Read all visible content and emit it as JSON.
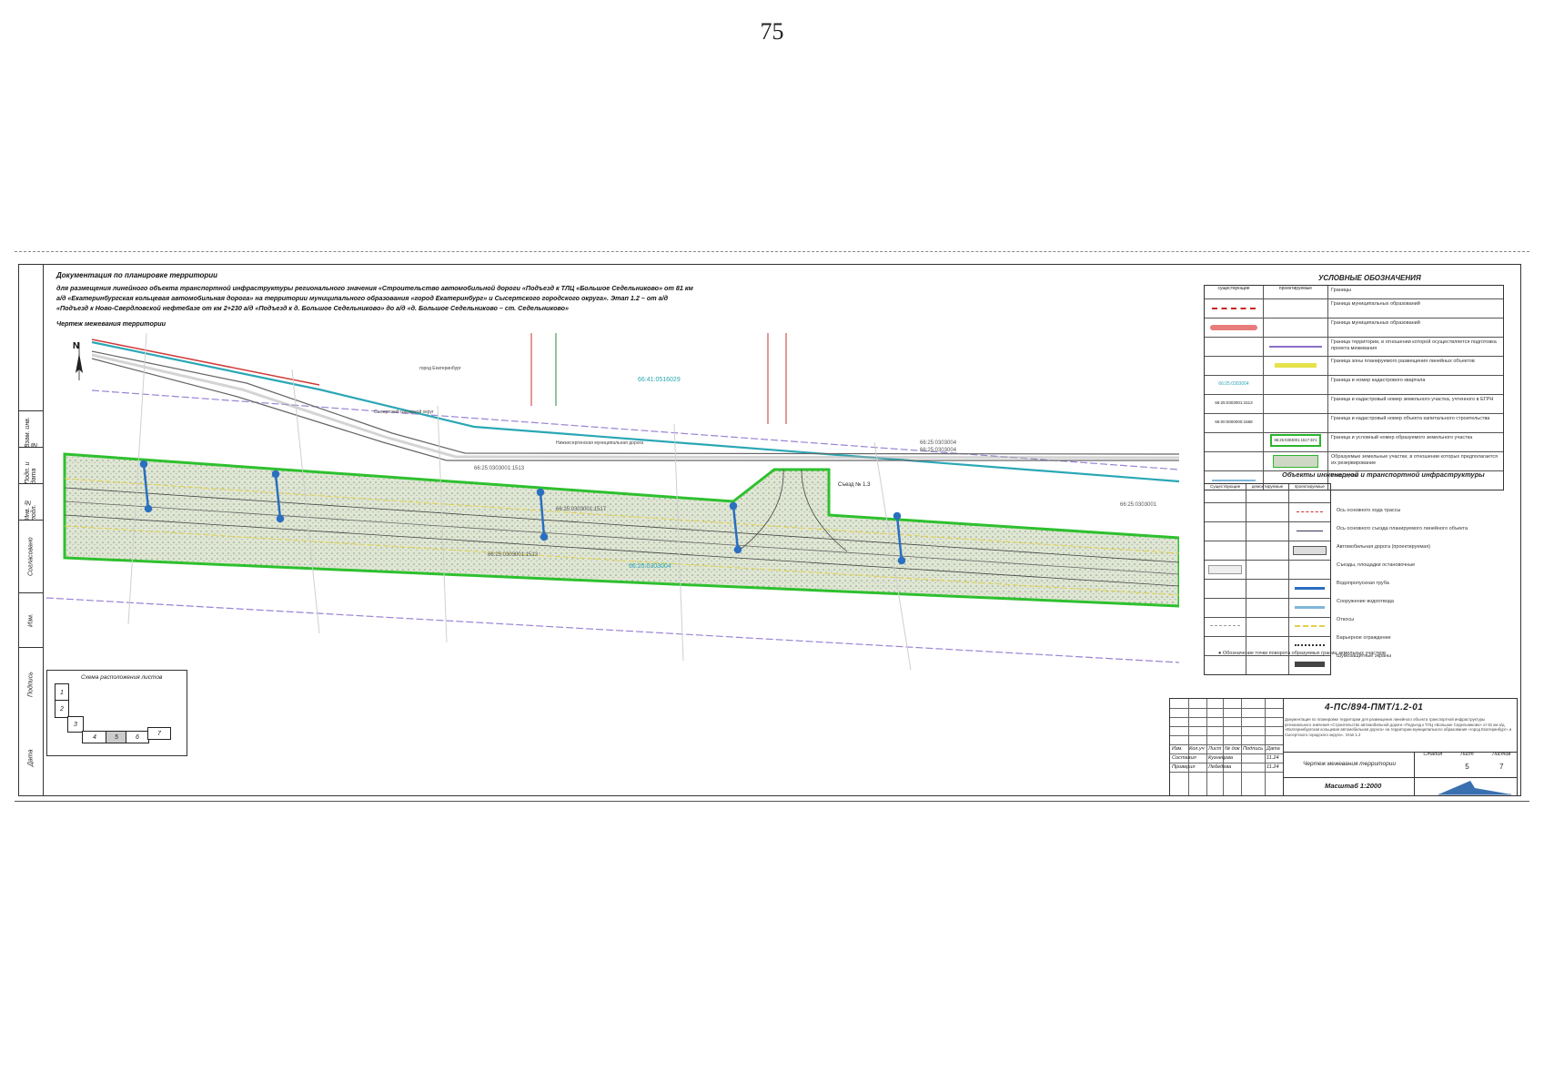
{
  "page": {
    "number": "75"
  },
  "header": {
    "title": "Документация по планировке территории",
    "description": "для размещения линейного объекта транспортной инфраструктуры регионального значения «Строительство автомобильной дороги «Подъезд к ТЛЦ «Большое Седельниково» от 81 км а/д «Екатеринбургская кольцевая автомобильная дорога» на территории муниципального образования «город Екатеринбург» и Сысертского городского округа». Этап 1.2 – от а/д «Подъезд к Ново-Свердловской нефтебазе от км 2+230 а/д «Подъезд к д. Большое Седельниково» до а/д «д. Большое Седельниково – ст. Седельниково»",
    "drawing_title": "Чертеж межевания территории"
  },
  "left_stamp": [
    "Взам. инв. №",
    "Подп. и дата",
    "Инв. № подл.",
    "Согласовано",
    "Изм.",
    "Подпись",
    "Дата"
  ],
  "drawing": {
    "north": "N",
    "cadastral_labels": [
      "66:41:0516029",
      "66:25:0303001:1513",
      "66:25:0303004",
      "66:25:0303001:1517",
      "66:25:0303001:1513",
      "66:25:0303004",
      "66:25:0303004",
      "66:25:0303001"
    ],
    "exit_label": "Съезд № 1.3",
    "road_label_upper": "Сысертский городской округ",
    "road_label_lower": "Нижнесергинская муниципальная дорога",
    "city_label": "город Екатеринбург"
  },
  "legend": {
    "title": "УСЛОВНЫЕ ОБОЗНАЧЕНИЯ",
    "col_headers": [
      "Границы",
      "существующие",
      "проектируемые"
    ],
    "items": [
      {
        "label": "Граница муниципальных образований",
        "color": "#cc2222"
      },
      {
        "label": "Граница муниципальных образований",
        "color": "#e87c7c"
      },
      {
        "label": "Граница территории, в отношении которой осуществляется подготовка проекта межевания",
        "color": "#8a6fc6"
      },
      {
        "label": "Граница зоны планируемого размещения линейных объектов",
        "color": "#e6e24a"
      },
      {
        "label": "Граница и номер кадастрового квартала",
        "color": "#2aa7b5"
      },
      {
        "label": "Граница и кадастровый номер земельного участка, учтенного в ЕГРН",
        "color": "#777777"
      },
      {
        "label": "Граница и кадастровый номер объекта капитального строительства",
        "color": "#555555"
      },
      {
        "label": "Граница и условный номер образуемого земельного участка",
        "color": "#2bb52b"
      },
      {
        "label": "Образуемые земельные участки, в отношении которых предполагается их резервирование",
        "color": "#888888"
      },
      {
        "label": "Река, ручей",
        "color": "#7fb6d8"
      }
    ],
    "item_codes": [
      "66:25:0303004",
      "66:25:0303001:1513",
      "66:00:0000000:1568",
      "66:25:0303001:1517:ЗУ1"
    ]
  },
  "infrastructure": {
    "title": "Объекты инженерной и транспортной инфраструктуры",
    "headers": [
      "Существующие",
      "демонтируемые",
      "проектируемые"
    ],
    "items": [
      "Ось основного хода трассы",
      "Ось основного съезда планируемого линейного объекта",
      "Автомобильная дорога (проектируемая)",
      "Съезды, площадки остановочные",
      "Водопропускная труба",
      "Сооружение водоотвода",
      "Откосы",
      "Барьерное ограждение",
      "Шумозащитные экраны"
    ],
    "footnote": "Обозначение точки поворота образуемых границ земельных участков"
  },
  "stamp": {
    "code": "4-ПС/894-ПМТ/1.2-01",
    "description": "Документация по планировке территории для размещения линейного объекта транспортной инфраструктуры регионального значения «Строительство автомобильной дороги «Подъезд к ТЛЦ «Большое Седельниково» от 81 км а/д «Екатеринбургская кольцевая автомобильная дорога» на территории муниципального образования «город Екатеринбург» и Сысертского городского округа». Этап 1.2",
    "columns": [
      "Изм.",
      "Кол.уч",
      "Лист",
      "№ док",
      "Подпись",
      "Дата"
    ],
    "people": [
      {
        "role": "Составил",
        "name": "Кузнецова",
        "date": "11.24"
      },
      {
        "role": "Проверил",
        "name": "Лебедева",
        "date": "11.24"
      }
    ],
    "stage_headers": [
      "Стадия",
      "Лист",
      "Листов"
    ],
    "sheet": "5",
    "sheets": "7",
    "drawing_name": "Чертеж межевания территории",
    "scale": "Масштаб 1:2000"
  },
  "scheme": {
    "title": "Схема расположения листов",
    "boxes": [
      "1",
      "2",
      "3",
      "4",
      "5",
      "6",
      "7"
    ]
  }
}
